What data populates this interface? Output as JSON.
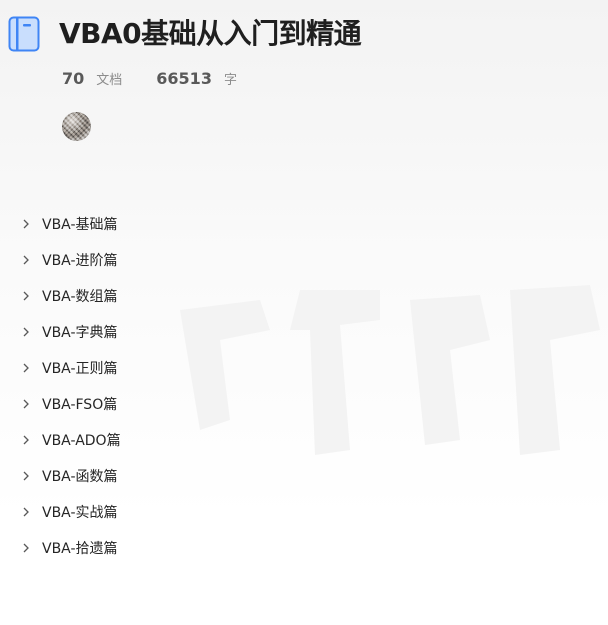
{
  "book": {
    "title": "VBA0基础从入门到精通",
    "icon": "book-icon",
    "doc_count": "70",
    "doc_label": "文档",
    "word_count": "66513",
    "word_label": "字"
  },
  "colors": {
    "title": "#1f1f1f",
    "icon_blue": "#3f85f5",
    "icon_fill": "#c9defd",
    "muted": "#8c8c8c"
  },
  "toc": {
    "icon": "chevron-right-icon",
    "items": [
      {
        "label": "VBA-基础篇"
      },
      {
        "label": "VBA-进阶篇"
      },
      {
        "label": "VBA-数组篇"
      },
      {
        "label": "VBA-字典篇"
      },
      {
        "label": "VBA-正则篇"
      },
      {
        "label": "VBA-FSO篇"
      },
      {
        "label": "VBA-ADO篇"
      },
      {
        "label": "VBA-函数篇"
      },
      {
        "label": "VBA-实战篇"
      },
      {
        "label": "VBA-拾遗篇"
      }
    ]
  }
}
